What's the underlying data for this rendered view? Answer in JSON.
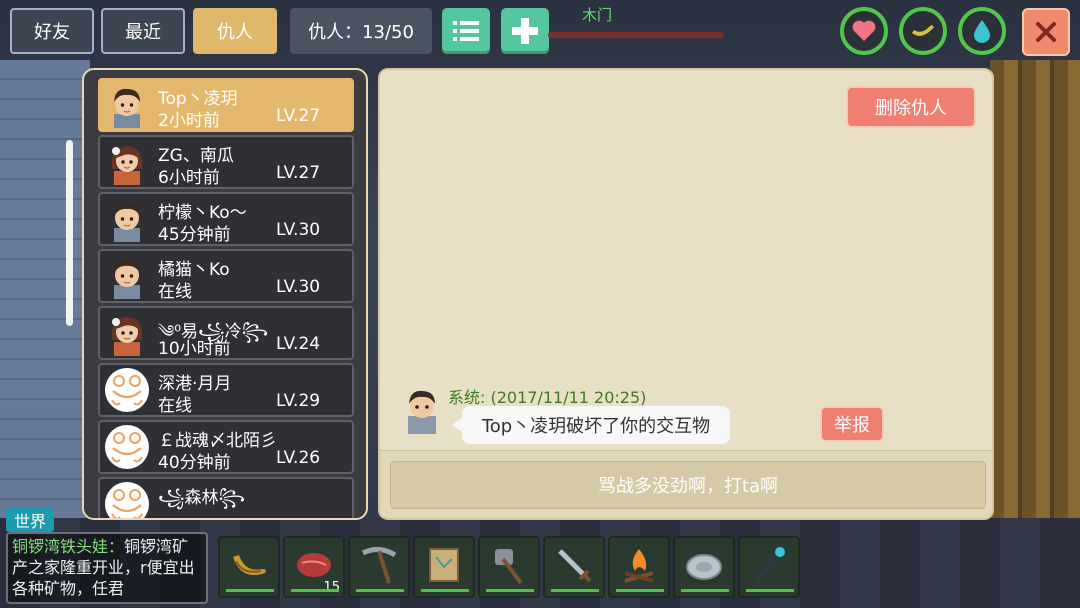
{
  "tabs": [
    {
      "label": "好友",
      "active": false
    },
    {
      "label": "最近",
      "active": false
    },
    {
      "label": "仇人",
      "active": true
    }
  ],
  "counter": {
    "text": "仇人：13/50"
  },
  "toolbar": {
    "list_icon": "list-icon",
    "add_icon": "plus-icon"
  },
  "status": {
    "target_label": "木门",
    "stats": [
      "heart-icon",
      "banana-icon",
      "water-drop-icon"
    ],
    "close_icon": "close-icon"
  },
  "enemies": [
    {
      "name": "Top丶凌玥",
      "time": "2小时前",
      "level": "LV.27",
      "avatar": "boy",
      "selected": true
    },
    {
      "name": "ZG、南瓜",
      "time": "6小时前",
      "level": "LV.27",
      "avatar": "girl",
      "selected": false
    },
    {
      "name": "柠檬丶Ko～",
      "time": "45分钟前",
      "level": "LV.30",
      "avatar": "boy",
      "selected": false
    },
    {
      "name": "橘猫丶Ko",
      "time": "在线",
      "level": "LV.30",
      "avatar": "boy",
      "selected": false
    },
    {
      "name": "༄⁰易꧁冷꧂",
      "time": "10小时前",
      "level": "LV.24",
      "avatar": "girl",
      "selected": false
    },
    {
      "name": "深港·月月",
      "time": "在线",
      "level": "LV.29",
      "avatar": "frog",
      "selected": false
    },
    {
      "name": "￡战魂〆北陌彡",
      "time": "40分钟前",
      "level": "LV.26",
      "avatar": "frog",
      "selected": false
    },
    {
      "name": "꧁森林꧂",
      "time": "",
      "level": "",
      "avatar": "frog",
      "selected": false
    }
  ],
  "detail": {
    "delete_button": "删除仇人",
    "message": {
      "sender": "系统: (2017/11/11 20:25)",
      "text": "Top丶凌玥破坏了你的交互物"
    },
    "report_button": "举报",
    "input_placeholder": "骂战多没劲啊，打ta啊"
  },
  "chat": {
    "channel": "世界",
    "sender": "铜锣湾铁头娃：",
    "text": "铜锣湾矿产之家隆重开业，r便宜出各种矿物，任君"
  },
  "hotbar": [
    {
      "icon": "banana-icon",
      "count": ""
    },
    {
      "icon": "raw-meat-icon",
      "count": "15"
    },
    {
      "icon": "pickaxe-icon",
      "count": ""
    },
    {
      "icon": "map-scroll-icon",
      "count": ""
    },
    {
      "icon": "stone-axe-icon",
      "count": ""
    },
    {
      "icon": "sword-icon",
      "count": ""
    },
    {
      "icon": "campfire-icon",
      "count": ""
    },
    {
      "icon": "shield-icon",
      "count": ""
    },
    {
      "icon": "magic-staff-icon",
      "count": ""
    }
  ]
}
